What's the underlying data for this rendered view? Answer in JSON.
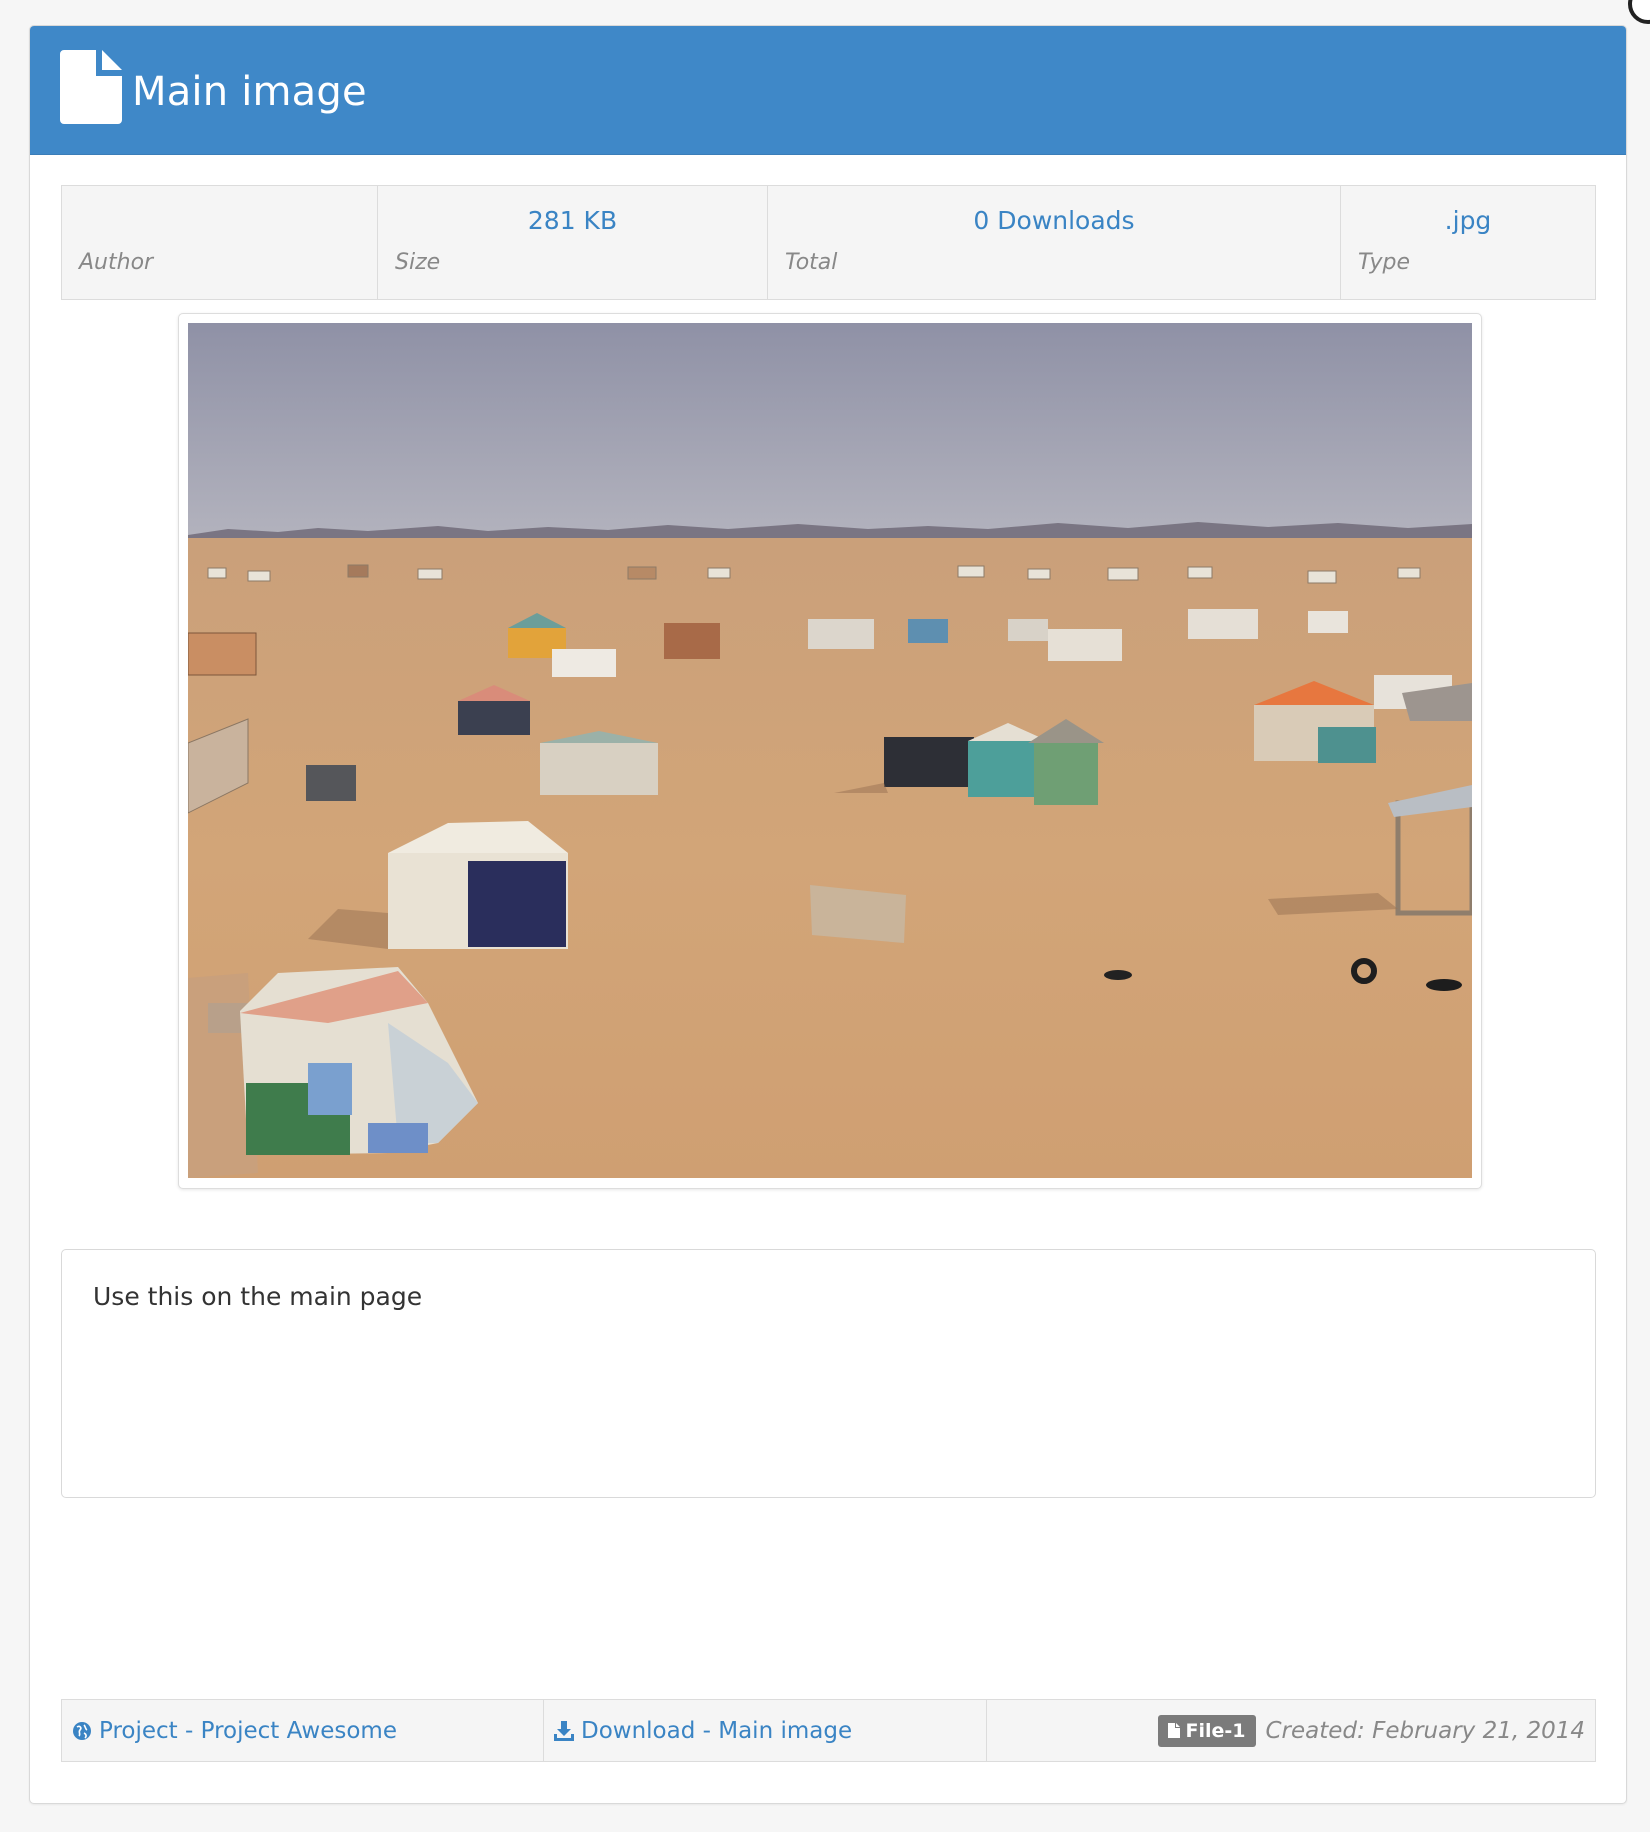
{
  "header": {
    "title": "Main image",
    "icon": "file-icon",
    "color": "#3f88c8"
  },
  "stats": [
    {
      "key": "author",
      "value": "",
      "label": "Author"
    },
    {
      "key": "size",
      "value": "281 KB",
      "label": "Size"
    },
    {
      "key": "total",
      "value": "0 Downloads",
      "label": "Total"
    },
    {
      "key": "type",
      "value": ".jpg",
      "label": "Type"
    }
  ],
  "image": {
    "subject": "desert-camp-photo"
  },
  "description": {
    "text": "Use this on the main page"
  },
  "footer": {
    "project_link": "Project - Project Awesome",
    "project_icon": "globe-icon",
    "download_link": "Download - Main image",
    "download_icon": "download-icon",
    "badge": "File-1",
    "badge_icon": "file-icon",
    "created": "Created: February 21, 2014"
  },
  "colors": {
    "accent": "#3a84c4",
    "badge": "#7b7b7b"
  }
}
